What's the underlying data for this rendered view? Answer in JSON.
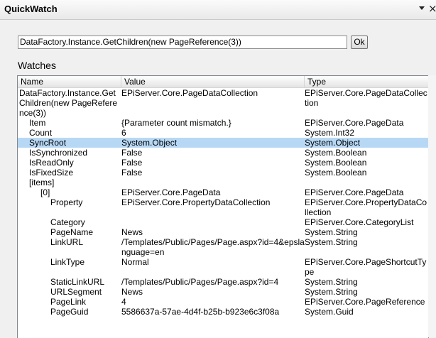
{
  "window": {
    "title": "QuickWatch",
    "dropdown_icon": "chevron-down-icon",
    "close_icon": "close-icon",
    "close_glyph": "×"
  },
  "expression": {
    "value": "DataFactory.Instance.GetChildren(new PageReference(3))",
    "ok_label": "Ok"
  },
  "watches": {
    "label": "Watches",
    "columns": [
      "Name",
      "Value",
      "Type"
    ],
    "rows": [
      {
        "name": "DataFactory.Instance.GetChildren(new PageReference(3))",
        "value": "EPiServer.Core.PageDataCollection",
        "type": "EPiServer.Core.PageDataCollection",
        "indent": 0
      },
      {
        "name": "Item",
        "value": "{Parameter count mismatch.}",
        "type": "EPiServer.Core.PageData",
        "indent": 1
      },
      {
        "name": "Count",
        "value": "6",
        "type": "System.Int32",
        "indent": 1
      },
      {
        "name": "SyncRoot",
        "value": "System.Object",
        "type": "System.Object",
        "indent": 1,
        "selected": true
      },
      {
        "name": "IsSynchronized",
        "value": "False",
        "type": "System.Boolean",
        "indent": 1
      },
      {
        "name": "IsReadOnly",
        "value": "False",
        "type": "System.Boolean",
        "indent": 1
      },
      {
        "name": "IsFixedSize",
        "value": "False",
        "type": "System.Boolean",
        "indent": 1
      },
      {
        "name": "[items]",
        "value": "",
        "type": "",
        "indent": 1
      },
      {
        "name": "[0]",
        "value": "EPiServer.Core.PageData",
        "type": "EPiServer.Core.PageData",
        "indent": 2
      },
      {
        "name": "Property",
        "value": "EPiServer.Core.PropertyDataCollection",
        "type": "EPiServer.Core.PropertyDataCollection",
        "indent": 3
      },
      {
        "name": "Category",
        "value": "",
        "type": "EPiServer.Core.CategoryList",
        "indent": 3
      },
      {
        "name": "PageName",
        "value": "News",
        "type": "System.String",
        "indent": 3
      },
      {
        "name": "LinkURL",
        "value": "/Templates/Public/Pages/Page.aspx?id=4&epslanguage=en",
        "type": "System.String",
        "indent": 3
      },
      {
        "name": "LinkType",
        "value": "Normal",
        "type": "EPiServer.Core.PageShortcutType",
        "indent": 3
      },
      {
        "name": "StaticLinkURL",
        "value": "/Templates/Public/Pages/Page.aspx?id=4",
        "type": "System.String",
        "indent": 3
      },
      {
        "name": "URLSegment",
        "value": "News",
        "type": "System.String",
        "indent": 3
      },
      {
        "name": "PageLink",
        "value": "4",
        "type": "EPiServer.Core.PageReference",
        "indent": 3
      },
      {
        "name": "PageGuid",
        "value": "5586637a-57ae-4d4f-b25b-b923e6c3f08a",
        "type": "System.Guid",
        "indent": 3
      }
    ]
  }
}
